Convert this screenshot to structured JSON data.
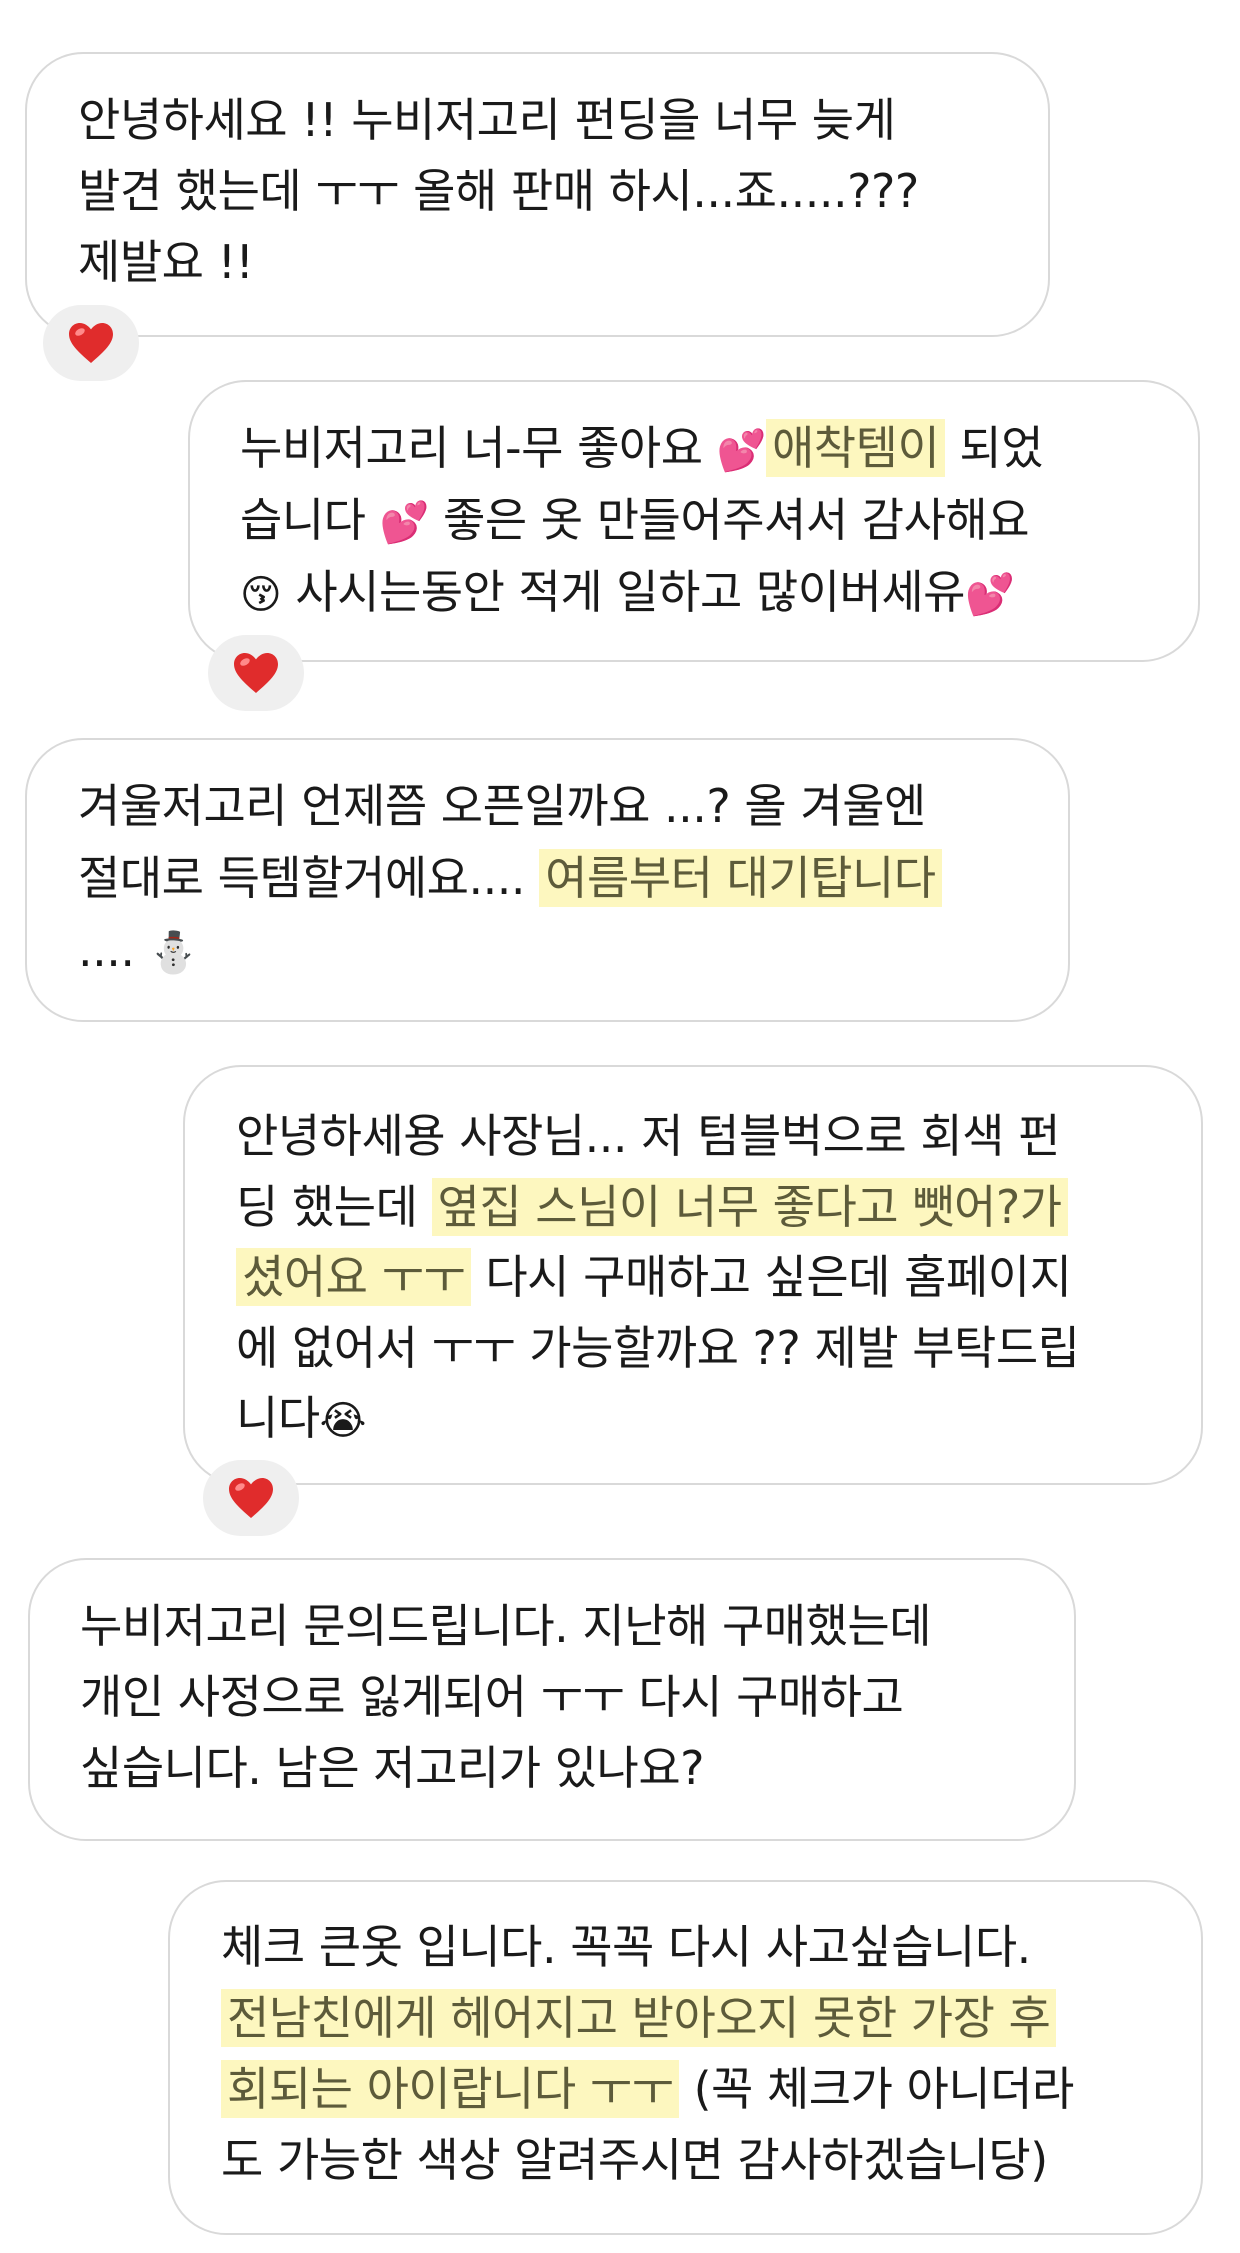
{
  "messages": [
    {
      "lines": [
        "안녕하세요 !! 누비저고리 펀딩을 너무 늦게",
        "발견 했는데 ㅜㅜ 올해 판매 하시...죠.....???",
        "제발요 !!"
      ],
      "reaction": "heart"
    },
    {
      "lines": [
        {
          "a": "누비저고리 너-무 좋아요 ",
          "e1": "💕",
          "hl": "애착템이",
          "b": " 되었"
        },
        {
          "a": "습니다 ",
          "e1": "💕",
          "b": " 좋은 옷 만들어주셔서 감사해요"
        },
        {
          "e0": "😚",
          "a": " 사시는동안 적게 일하고 많이버세유",
          "e1": "💕"
        }
      ],
      "reaction": "heart"
    },
    {
      "lines": [
        "겨울저고리 언제쯤 오픈일까요 ...? 올 겨울엔",
        {
          "a": "절대로 득템할거에요.... ",
          "hl": "여름부터 대기탑니다"
        },
        {
          "a": ".... ",
          "e1": "⛄"
        }
      ]
    },
    {
      "lines": [
        "안녕하세용 사장님... 저 텀블벅으로 회색 펀",
        {
          "a": "딩 했는데 ",
          "hl": "옆집 스님이 너무 좋다고 뺏어?가"
        },
        {
          "hl": "셨어요 ㅜㅜ",
          "b": " 다시 구매하고 싶은데 홈페이지"
        },
        "에 없어서 ㅜㅜ 가능할까요 ?? 제발 부탁드립",
        {
          "a": "니다",
          "e1": "😭"
        }
      ],
      "reaction": "heart"
    },
    {
      "lines": [
        "누비저고리 문의드립니다. 지난해 구매했는데",
        "개인 사정으로 잃게되어 ㅜㅜ 다시 구매하고",
        "싶습니다. 남은 저고리가 있나요?"
      ]
    },
    {
      "lines": [
        "체크 큰옷 입니다. 꼭꼭 다시 사고싶습니다.",
        {
          "hl": "전남친에게 헤어지고 받아오지 못한 가장 후"
        },
        {
          "hl": "회되는 아이랍니다 ㅜㅜ",
          "b": "  (꼭 체크가 아니더라"
        },
        "도 가능한 색상 알려주시면 감사하겠습니당)"
      ]
    }
  ],
  "colors": {
    "bubble_border": "#d9d9d9",
    "highlight": "#fdf7bf",
    "highlight_text": "#5d5b3a",
    "reaction_bg": "#efefef",
    "heart": "#e02c2c"
  }
}
